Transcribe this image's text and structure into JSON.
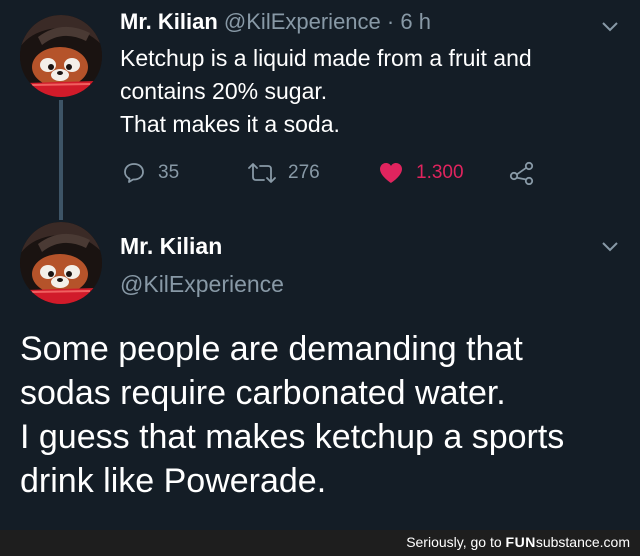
{
  "tweet1": {
    "name": "Mr. Kilian",
    "handle": "@KilExperience",
    "separator": " · ",
    "time": "6 h",
    "lines": [
      "Ketchup is a liquid made from a fruit and",
      "contains 20% sugar.",
      "That makes it a soda."
    ],
    "reply_count": "35",
    "retweet_count": "276",
    "like_count": "1.300",
    "like_color": "#e0245e"
  },
  "tweet2": {
    "name": "Mr. Kilian",
    "handle": "@KilExperience",
    "lines": [
      "Some people are demanding that",
      "sodas require carbonated water.",
      "I guess that makes ketchup a sports",
      "drink like Powerade."
    ]
  },
  "watermark": {
    "prefix": "Seriously, go to ",
    "brand_fun": "FUN",
    "brand_substance": "substance",
    "suffix": ".com"
  },
  "icons": {
    "reply": "reply-icon",
    "retweet": "retweet-icon",
    "like": "heart-icon",
    "share": "share-icon",
    "menu": "chevron-down-icon"
  },
  "colors": {
    "background": "#141d26",
    "secondary_text": "#8899a6"
  }
}
